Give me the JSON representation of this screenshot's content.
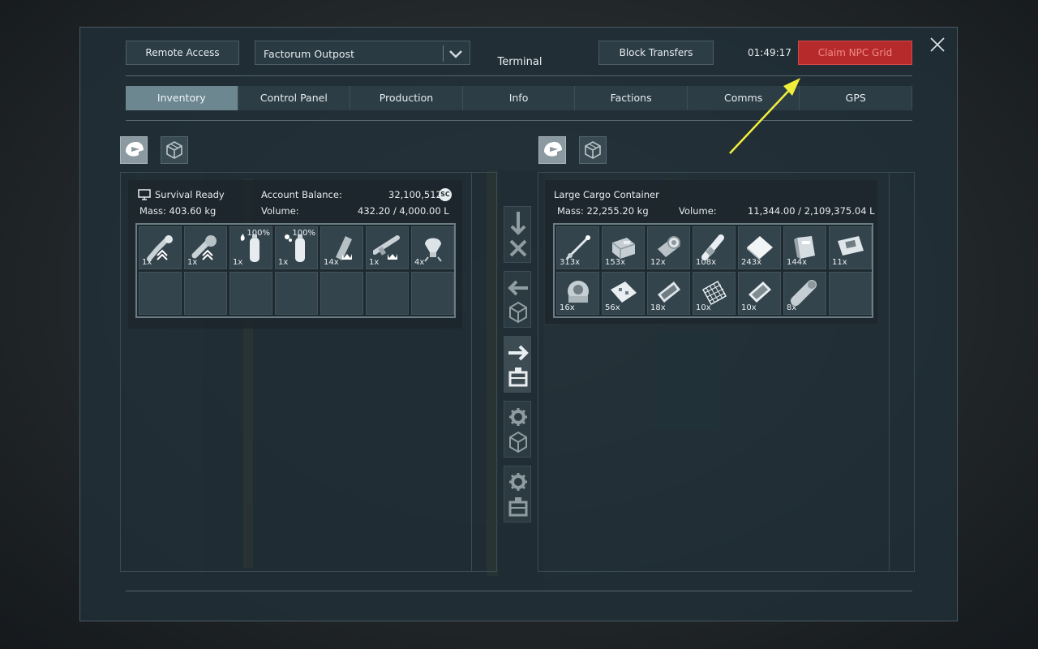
{
  "toolbar": {
    "remote_access": "Remote Access",
    "grid_select": "Factorum Outpost",
    "title": "Terminal",
    "block_transfers": "Block Transfers",
    "time": "01:49:17",
    "claim": "Claim NPC Grid"
  },
  "tabs": [
    "Inventory",
    "Control Panel",
    "Production",
    "Info",
    "Factions",
    "Comms",
    "GPS"
  ],
  "active_tab": "Inventory",
  "left": {
    "source": "Survival Ready",
    "balance_label": "Account Balance:",
    "balance_value": "32,100,512",
    "currency": "SC",
    "mass_label": "Mass: 403.60 kg",
    "volume_label": "Volume:",
    "volume_value": "432.20 / 4,000.00 L",
    "items": [
      {
        "qty": "1x",
        "icon": "welder-icon",
        "pct": ""
      },
      {
        "qty": "1x",
        "icon": "grinder-icon",
        "pct": ""
      },
      {
        "qty": "1x",
        "icon": "hydrogen-bottle-icon",
        "pct": "100%"
      },
      {
        "qty": "1x",
        "icon": "oxygen-bottle-icon",
        "pct": "100%"
      },
      {
        "qty": "14x",
        "icon": "ammo-magazine-icon",
        "pct": ""
      },
      {
        "qty": "1x",
        "icon": "rifle-icon",
        "pct": ""
      },
      {
        "qty": "4x",
        "icon": "gravel-icon",
        "pct": ""
      }
    ]
  },
  "right": {
    "container": "Large Cargo Container",
    "mass_label": "Mass: 22,255.20 kg",
    "volume_label": "Volume:",
    "volume_value": "11,344.00 / 2,109,375.04 L",
    "items": [
      {
        "qty": "313x",
        "icon": "steel-tube-icon"
      },
      {
        "qty": "153x",
        "icon": "motor-icon"
      },
      {
        "qty": "12x",
        "icon": "thruster-component-icon"
      },
      {
        "qty": "108x",
        "icon": "large-tube-icon"
      },
      {
        "qty": "243x",
        "icon": "steel-plate-icon"
      },
      {
        "qty": "144x",
        "icon": "construction-comp-icon"
      },
      {
        "qty": "11x",
        "icon": "computer-icon"
      },
      {
        "qty": "16x",
        "icon": "reactor-comp-icon"
      },
      {
        "qty": "56x",
        "icon": "interior-plate-icon"
      },
      {
        "qty": "18x",
        "icon": "display-icon"
      },
      {
        "qty": "10x",
        "icon": "metal-grid-icon"
      },
      {
        "qty": "10x",
        "icon": "bulletproof-glass-icon"
      },
      {
        "qty": "8x",
        "icon": "detector-comp-icon"
      }
    ]
  },
  "colors": {
    "accent_active_tab": "#6d8791",
    "claim_bg": "#b72a2c",
    "claim_text": "#f08a86",
    "arrow": "#f2ef3a"
  }
}
